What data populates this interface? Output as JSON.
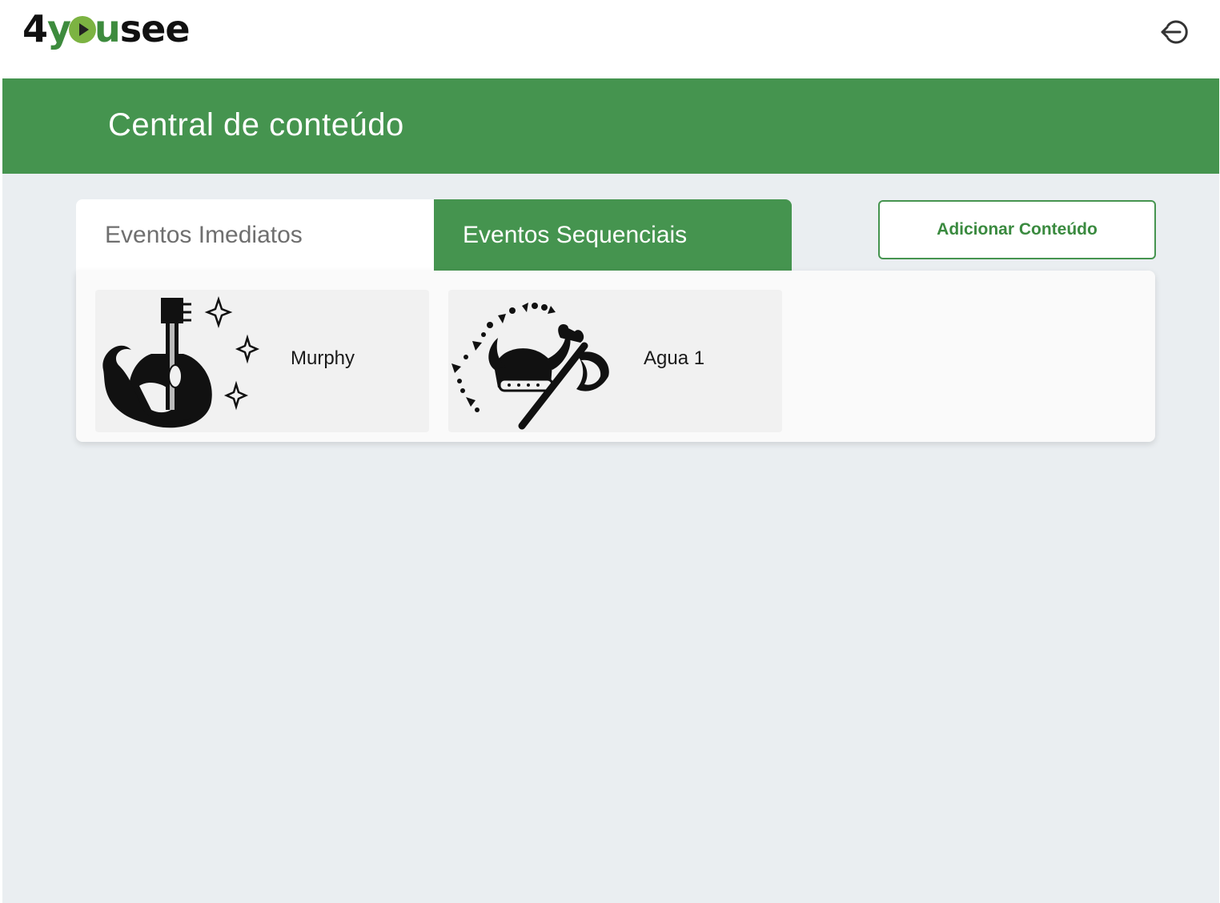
{
  "brand": {
    "logo_prefix": "4",
    "logo_green": "y",
    "logo_suffix_green": "u",
    "logo_suffix": "see",
    "logo_full": "4yousee"
  },
  "header": {
    "title": "Central de conteúdo"
  },
  "tabs": [
    {
      "label": "Eventos Imediatos",
      "active": false
    },
    {
      "label": "Eventos Sequenciais",
      "active": true
    }
  ],
  "actions": {
    "add_content_label": "Adicionar Conteúdo",
    "logout_icon": "logout-icon"
  },
  "items": [
    {
      "name": "Murphy",
      "icon": "lute-sparkles-icon"
    },
    {
      "name": "Agua 1",
      "icon": "viking-axe-icon"
    }
  ],
  "colors": {
    "primary_green": "#45944f",
    "background": "#eaeef1",
    "card_bg": "#f1f1f1"
  }
}
